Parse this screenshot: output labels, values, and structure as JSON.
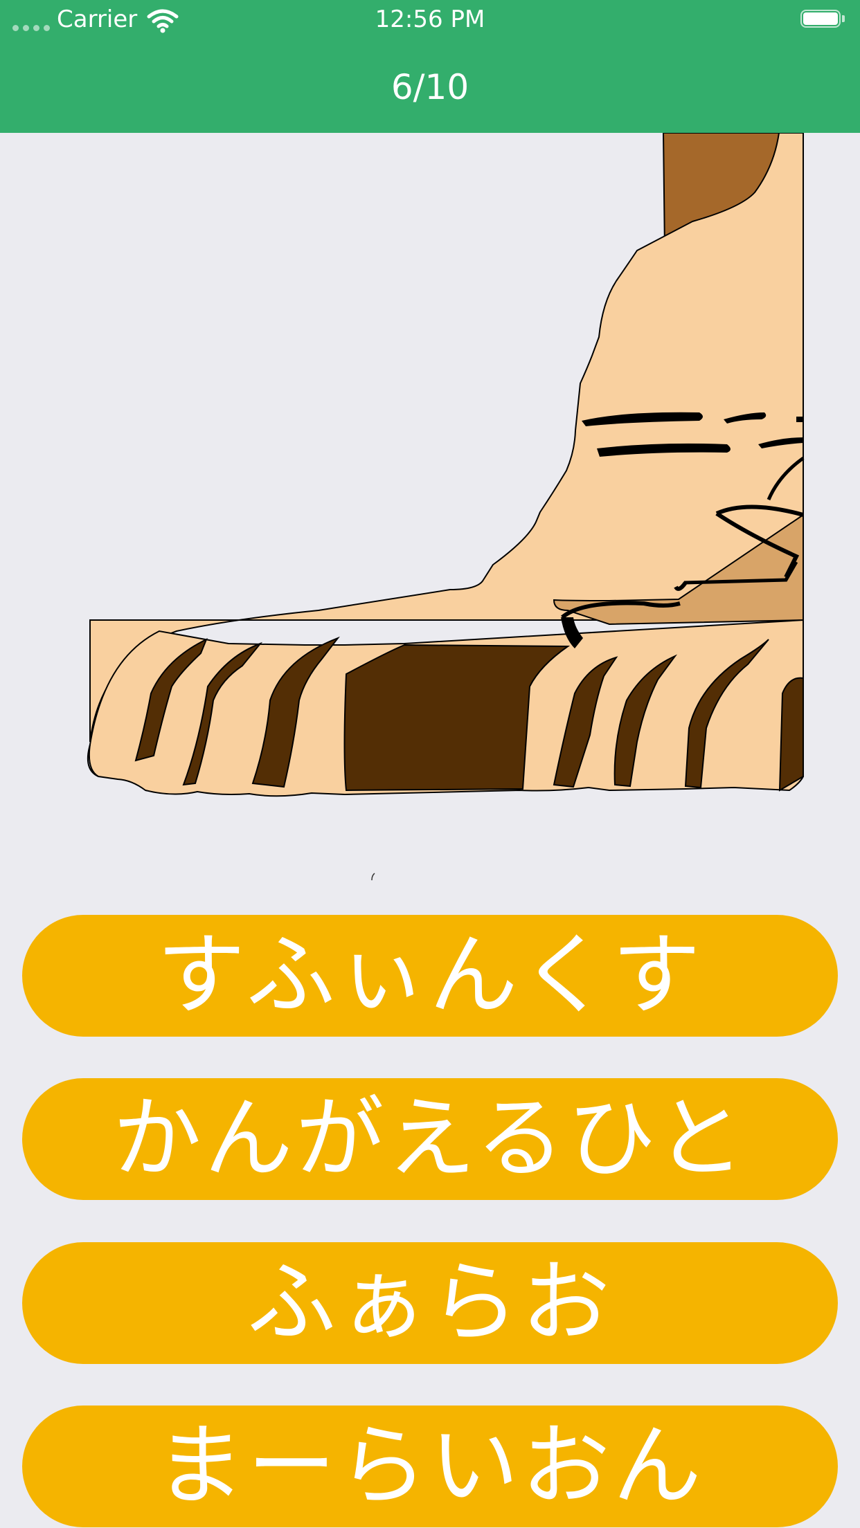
{
  "status_bar": {
    "carrier": "Carrier",
    "time": "12:56 PM",
    "wifi_icon": "wifi-icon",
    "battery_icon": "battery-full-icon",
    "signal_icon": "signal-dots-icon"
  },
  "header": {
    "progress": "6/10",
    "color": "#33ae6c"
  },
  "quiz": {
    "image_icon": "sphinx-paw-illustration",
    "answers": [
      {
        "label": "すふぃんくす"
      },
      {
        "label": "かんがえるひと"
      },
      {
        "label": "ふぁらお"
      },
      {
        "label": "まーらいおん"
      }
    ],
    "answer_color": "#f5b400"
  },
  "colors": {
    "background": "#ebebf0",
    "skin": "#f9d09f",
    "dark_brown": "#532e05",
    "brown": "#a5682a",
    "tan": "#d8a468"
  }
}
